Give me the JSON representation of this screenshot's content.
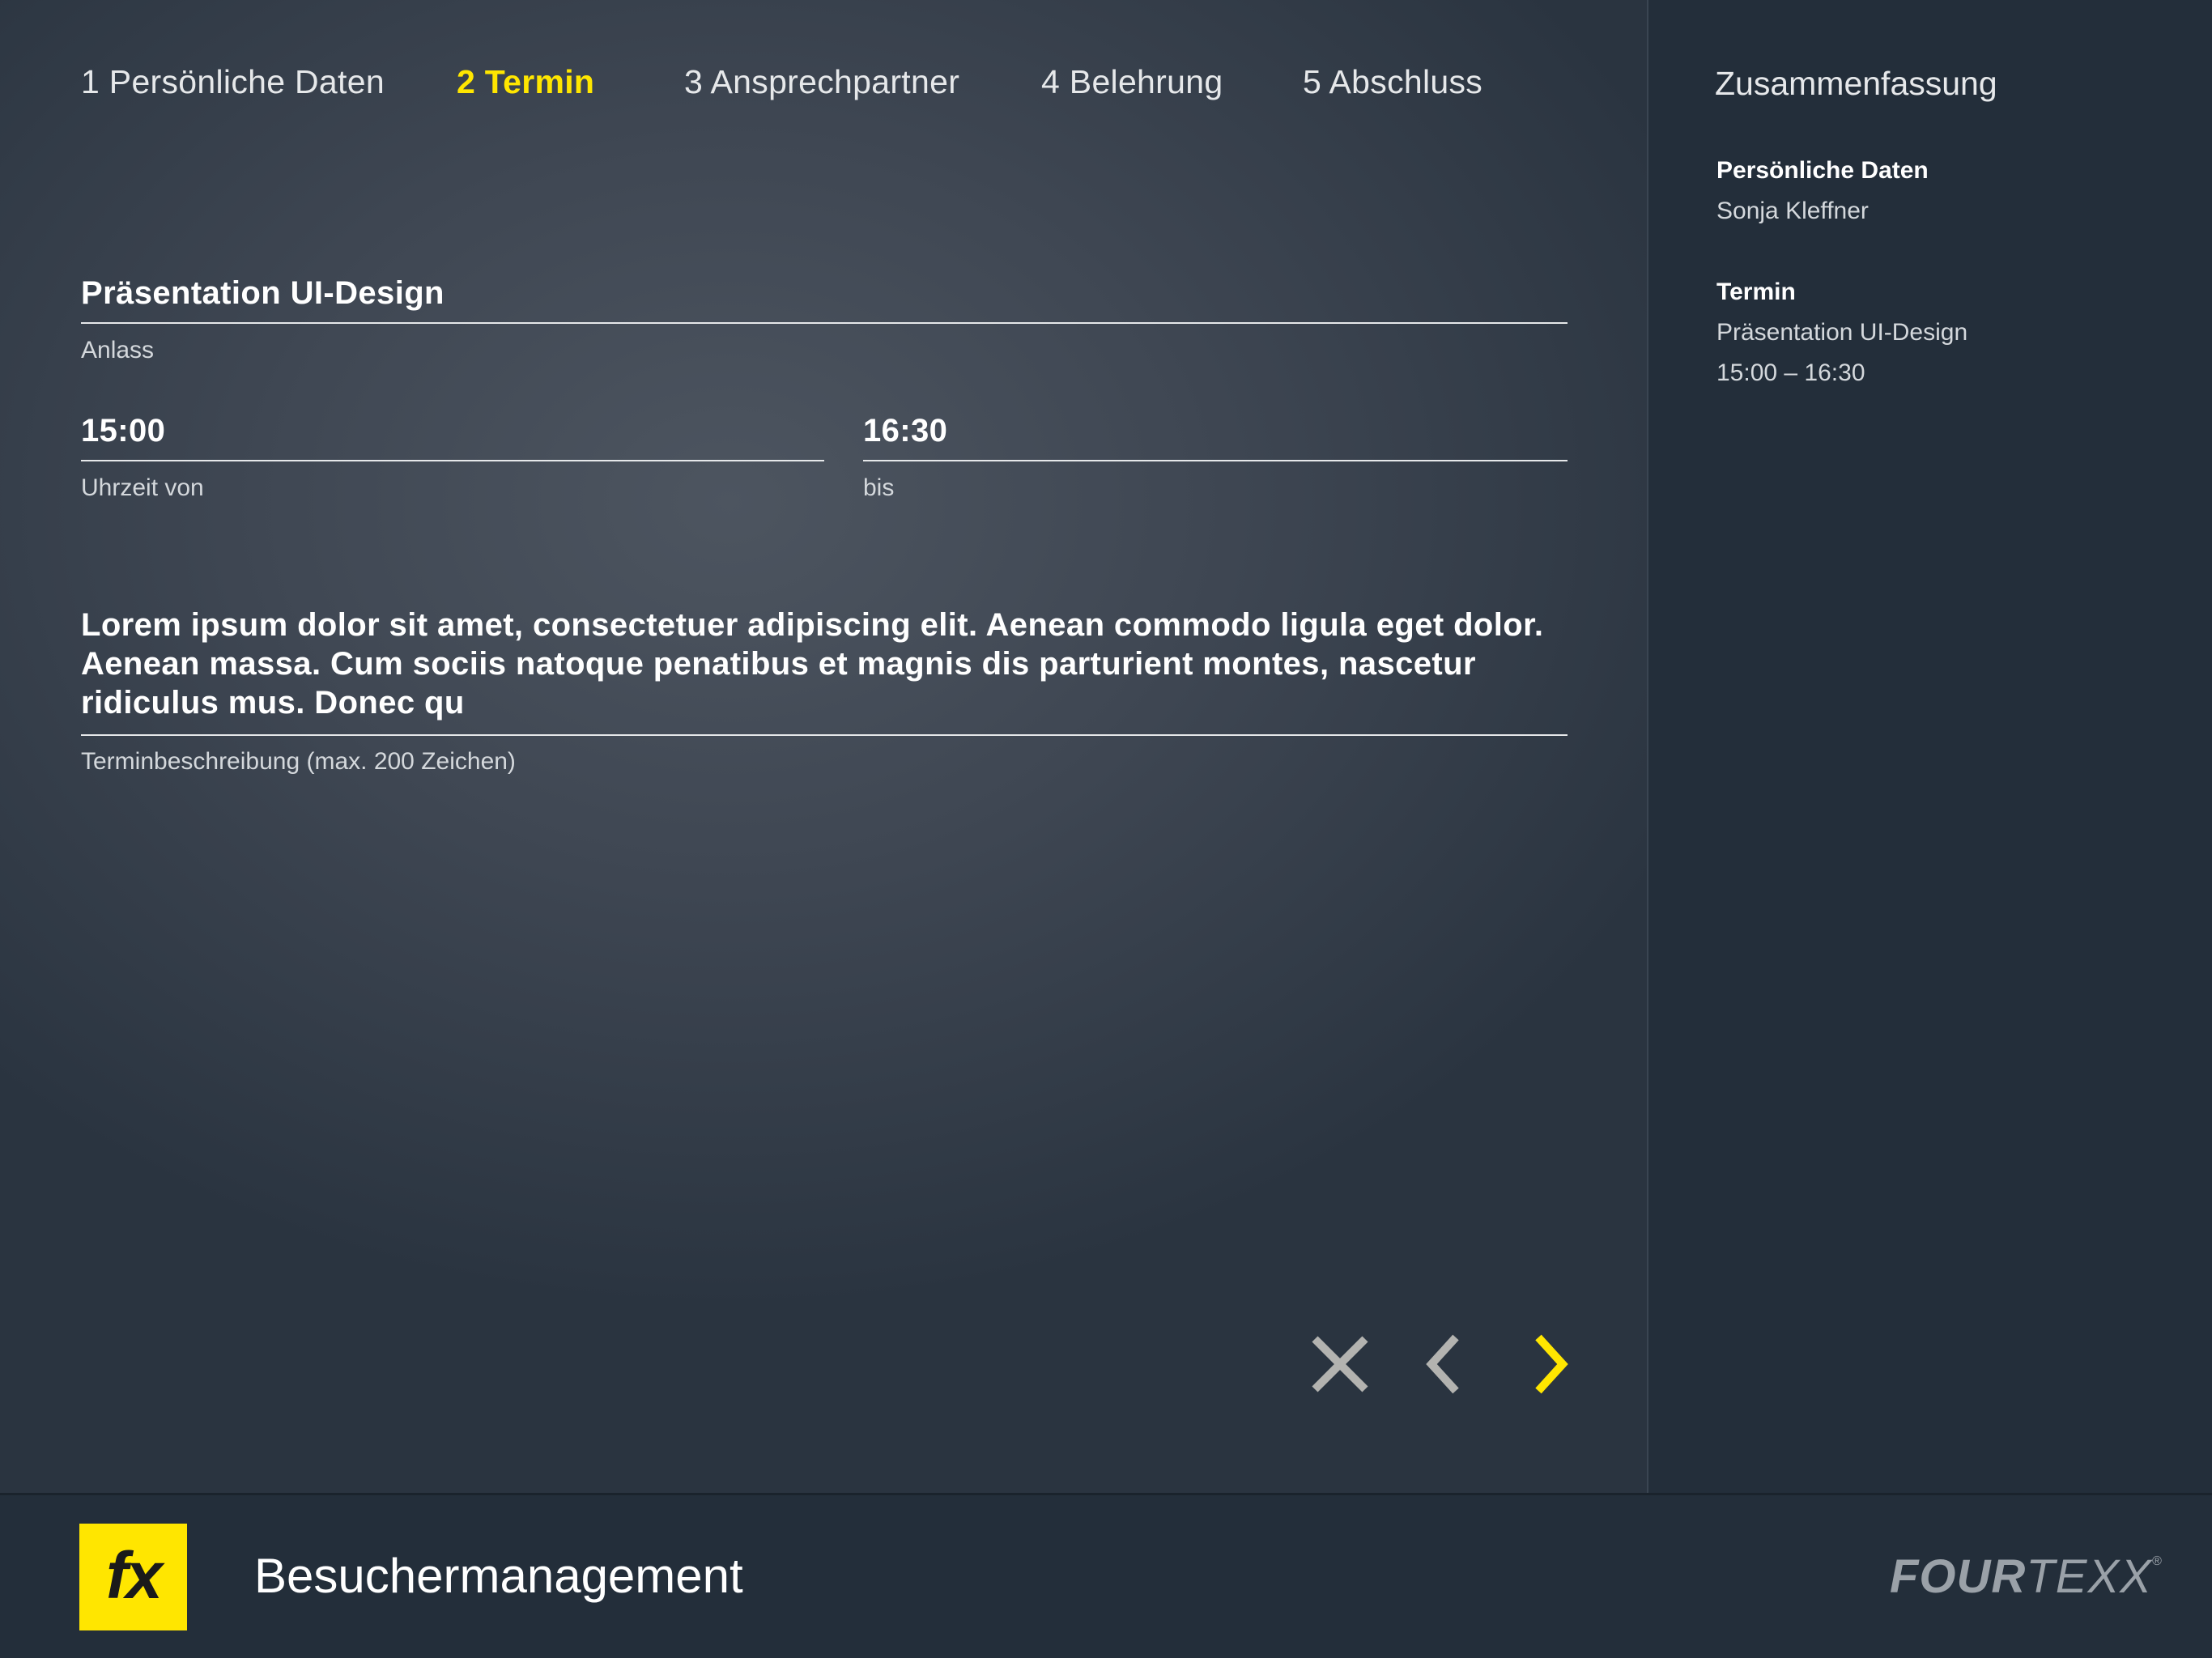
{
  "steps": [
    {
      "label": "1 Persönliche Daten"
    },
    {
      "label": "2 Termin"
    },
    {
      "label": "3 Ansprechpartner"
    },
    {
      "label": "4 Belehrung"
    },
    {
      "label": "5 Abschluss"
    }
  ],
  "active_step": "2 Termin",
  "form": {
    "anlass": {
      "value": "Präsentation UI-Design",
      "label": "Anlass"
    },
    "uhrzeit_von": {
      "value": "15:00",
      "label": "Uhrzeit von"
    },
    "bis": {
      "value": "16:30",
      "label": "bis"
    },
    "beschreibung": {
      "value": "Lorem ipsum dolor sit amet, consectetuer adipiscing elit. Aenean commodo ligula eget dolor. Aenean massa. Cum sociis natoque penatibus et magnis dis parturient montes, nascetur ridiculus mus. Donec qu",
      "label": "Terminbeschreibung (max. 200 Zeichen)"
    }
  },
  "actions": {
    "cancel": "close-icon",
    "back": "chevron-left-icon",
    "next": "chevron-right-icon"
  },
  "summary": {
    "title": "Zusammenfassung",
    "personal": {
      "heading": "Persönliche Daten",
      "name": "Sonja Kleffner"
    },
    "termin": {
      "heading": "Termin",
      "anlass": "Präsentation UI-Design",
      "time": "15:00 – 16:30"
    }
  },
  "footer": {
    "logo": "fx",
    "app_title": "Besuchermanagement",
    "brand": {
      "part1": "FOUR",
      "part2": "TEXX",
      "mark": "®"
    }
  },
  "colors": {
    "accent": "#ffe600",
    "sidebar_bg": "#232e3a",
    "icon_inactive": "#b3b3b0"
  }
}
